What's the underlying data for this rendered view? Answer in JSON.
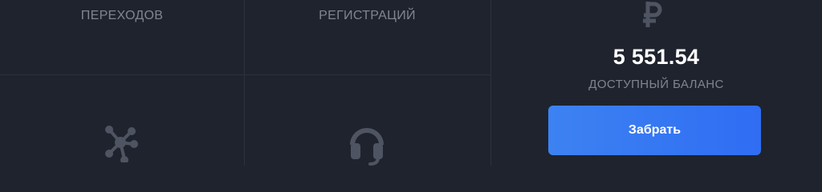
{
  "stats": {
    "clicks_label": "ПЕРЕХОДОВ",
    "registrations_label": "РЕГИСТРАЦИЙ"
  },
  "balance": {
    "currency_icon": "ruble-icon",
    "value": "5 551.54",
    "caption": "ДОСТУПНЫЙ БАЛАНС",
    "withdraw_label": "Забрать"
  },
  "icons": {
    "network": "network-icon",
    "support": "headset-icon"
  },
  "colors": {
    "background": "#1f232d",
    "divider": "#2c313c",
    "muted_text": "#7f8591",
    "icon": "#4e5461",
    "accent": "#3477f2"
  }
}
